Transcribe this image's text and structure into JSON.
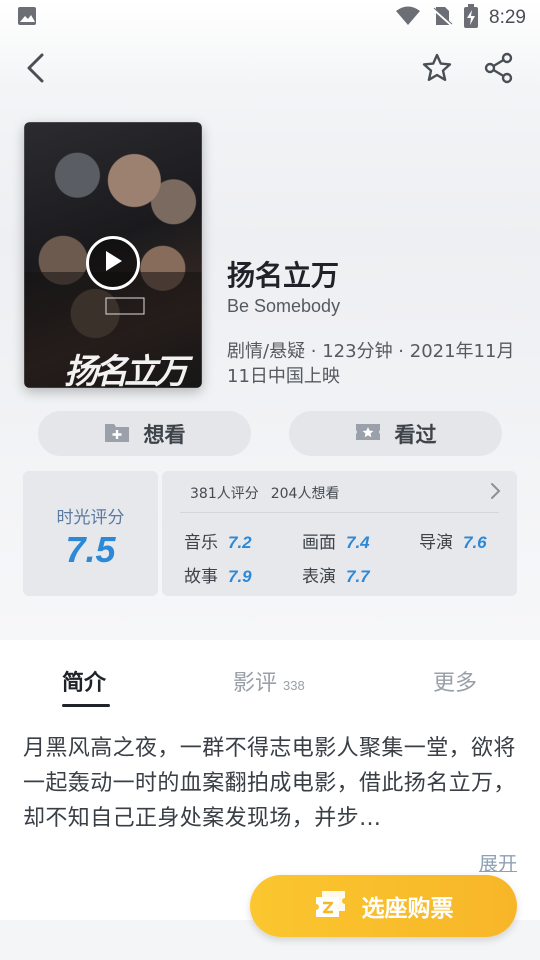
{
  "status_bar": {
    "time": "8:29"
  },
  "movie": {
    "title": "扬名立万",
    "subtitle": "Be Somebody",
    "meta": "剧情/悬疑 · 123分钟 · 2021年11月11日中国上映",
    "poster_text": "扬名立万"
  },
  "actions": {
    "want_label": "想看",
    "seen_label": "看过"
  },
  "rating": {
    "label": "时光评分",
    "score": "7.5",
    "rating_count": "381人评分",
    "want_count": "204人想看",
    "sub_scores": [
      {
        "label": "音乐",
        "value": "7.2"
      },
      {
        "label": "画面",
        "value": "7.4"
      },
      {
        "label": "导演",
        "value": "7.6"
      },
      {
        "label": "故事",
        "value": "7.9"
      },
      {
        "label": "表演",
        "value": "7.7"
      }
    ]
  },
  "tabs": [
    {
      "label": "简介",
      "count": ""
    },
    {
      "label": "影评",
      "count": "338"
    },
    {
      "label": "更多",
      "count": ""
    }
  ],
  "synopsis": {
    "text": "月黑风高之夜，一群不得志电影人聚集一堂，欲将一起轰动一时的血案翻拍成电影，借此扬名立万，却不知自己正身处案发现场，并步…",
    "expand_label": "展开"
  },
  "buy_button": {
    "label": "选座购票"
  },
  "colors": {
    "accent_blue": "#2d88d6",
    "buy_yellow": "#f7b628"
  },
  "icons": {
    "back": "back-arrow-icon",
    "favorite": "star-icon",
    "share": "share-icon",
    "play": "play-icon",
    "want": "folder-plus-icon",
    "seen": "ticket-star-icon",
    "buy": "ticket-icon"
  }
}
